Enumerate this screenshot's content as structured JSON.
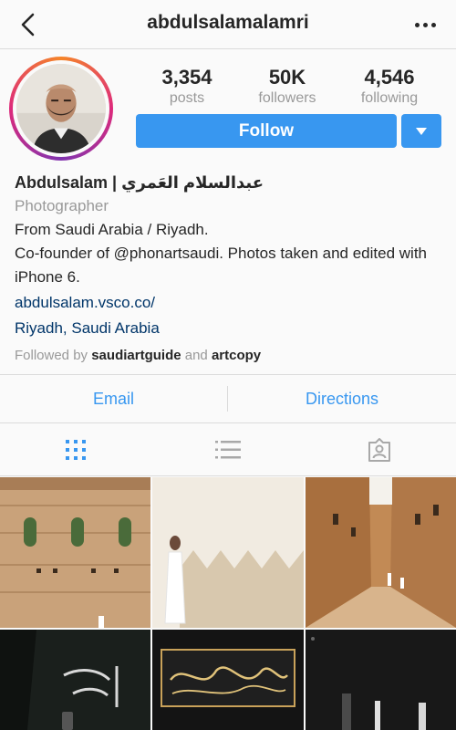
{
  "header": {
    "username": "abdulsalamalamri"
  },
  "stats": [
    {
      "value": "3,354",
      "label": "posts"
    },
    {
      "value": "50K",
      "label": "followers"
    },
    {
      "value": "4,546",
      "label": "following"
    }
  ],
  "actions": {
    "follow_label": "Follow"
  },
  "bio": {
    "name": "Abdulsalam | عبدالسلام العَمري",
    "category": "Photographer",
    "line1": "From Saudi Arabia / Riyadh.",
    "line2": "Co-founder of @phonartsaudi. Photos taken and edited with iPhone 6.",
    "website": "abdulsalam.vsco.co/",
    "location": "Riyadh, Saudi Arabia",
    "followed_prefix": "Followed by",
    "followed_user1": "saudiartguide",
    "followed_and": "and",
    "followed_user2": "artcopy"
  },
  "contact": {
    "email_label": "Email",
    "directions_label": "Directions"
  },
  "view_tabs": [
    "grid-icon",
    "list-icon",
    "tagged-icon"
  ],
  "colors": {
    "accent": "#3897f0",
    "link": "#003569",
    "muted": "#999999"
  }
}
